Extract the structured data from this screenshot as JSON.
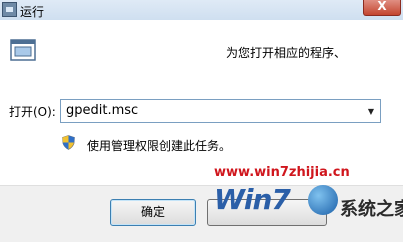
{
  "window": {
    "title": "运行",
    "close_label": "X"
  },
  "prompt_text": "为您打开相应的程序、",
  "open_field": {
    "label": "打开(O):",
    "value": "gpedit.msc"
  },
  "admin_notice": "使用管理权限创建此任务。",
  "buttons": {
    "ok": "确定",
    "cancel": ""
  },
  "watermark": {
    "url": "www.win7zhijia.cn",
    "logo_latin": "Win7",
    "logo_cjk": "系统之家"
  },
  "icons": {
    "app": "run-icon",
    "shield": "uac-shield-icon",
    "dropdown": "chevron-down-icon"
  },
  "colors": {
    "watermark_red": "#d0161d",
    "logo_blue": "#2b5fa8",
    "title_bar": "#cfdff0"
  }
}
